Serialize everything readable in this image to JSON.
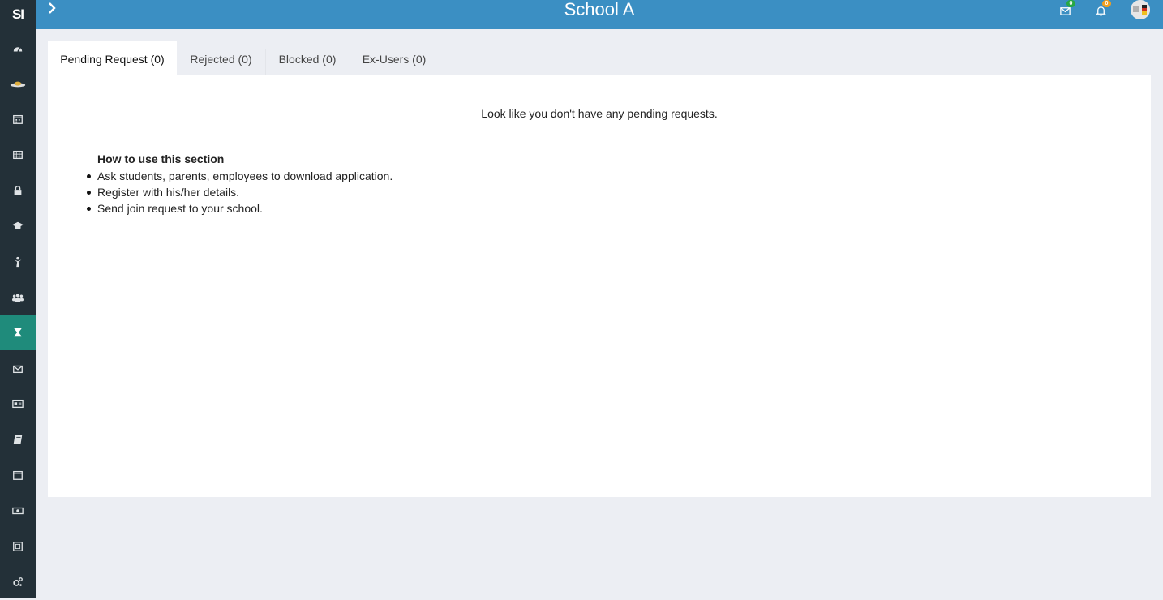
{
  "sidebar": {
    "logo": "SI",
    "icons": [
      "dashboard-icon",
      "hat-icon",
      "calendar-icon",
      "table-icon",
      "lock-icon",
      "graduation-cap-icon",
      "person-icon",
      "group-icon",
      "hourglass-icon",
      "mail-icon",
      "id-card-icon",
      "book-icon",
      "event-calendar-icon",
      "money-icon",
      "frame-icon",
      "settings-icon"
    ],
    "active": "hourglass-icon"
  },
  "header": {
    "title": "School A",
    "messages_count": "0",
    "notifications_count": "0",
    "colors": {
      "header_bg": "#3b8fc3",
      "messages_badge": "#27a844",
      "notifications_badge": "#f0a020"
    }
  },
  "tabs": [
    {
      "label": "Pending Request (0)",
      "active": true
    },
    {
      "label": "Rejected (0)",
      "active": false
    },
    {
      "label": "Blocked (0)",
      "active": false
    },
    {
      "label": "Ex-Users (0)",
      "active": false
    }
  ],
  "content": {
    "empty_message": "Look like you don't have any pending requests.",
    "howto_title": "How to use this section",
    "howto_steps": [
      "Ask students, parents, employees to download application.",
      "Register with his/her details.",
      "Send join request to your school."
    ]
  }
}
